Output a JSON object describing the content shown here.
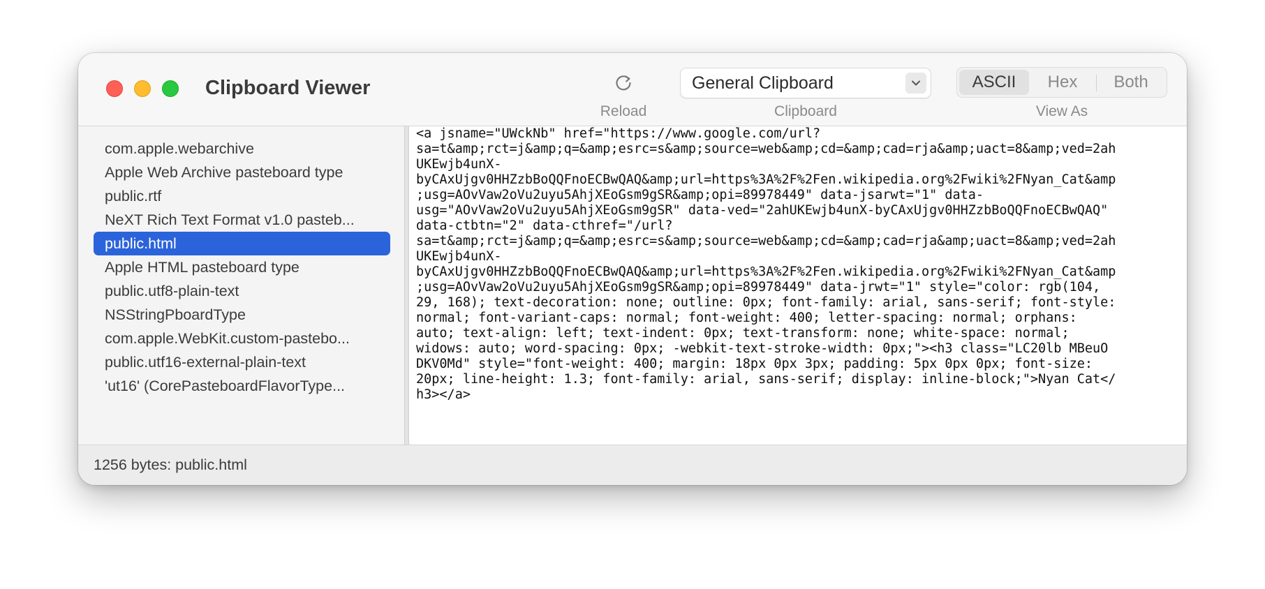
{
  "window": {
    "title": "Clipboard Viewer"
  },
  "toolbar": {
    "reload_icon": "reload-icon",
    "reload_label": "Reload",
    "clipboard_label": "Clipboard",
    "clipboard_value": "General Clipboard",
    "clipboard_chevron_icon": "chevron-down-icon",
    "view_as_label": "View As",
    "view_modes": [
      {
        "label": "ASCII",
        "selected": true
      },
      {
        "label": "Hex",
        "selected": false
      },
      {
        "label": "Both",
        "selected": false
      }
    ]
  },
  "sidebar": {
    "items": [
      {
        "label": "com.apple.webarchive"
      },
      {
        "label": "Apple Web Archive pasteboard type"
      },
      {
        "label": "public.rtf"
      },
      {
        "label": "NeXT Rich Text Format v1.0 pasteb..."
      },
      {
        "label": "public.html",
        "selected": true
      },
      {
        "label": "Apple HTML pasteboard type"
      },
      {
        "label": "public.utf8-plain-text"
      },
      {
        "label": "NSStringPboardType"
      },
      {
        "label": "com.apple.WebKit.custom-pastebo..."
      },
      {
        "label": "public.utf16-external-plain-text"
      },
      {
        "label": "'ut16' (CorePasteboardFlavorType..."
      }
    ]
  },
  "content": {
    "lines": [
      "<a jsname=\"UWckNb\" href=\"https://www.google.com/url?",
      "sa=t&amp;rct=j&amp;q=&amp;esrc=s&amp;source=web&amp;cd=&amp;cad=rja&amp;uact=8&amp;ved=2ah",
      "UKEwjb4unX-",
      "byCAxUjgv0HHZzbBoQQFnoECBwQAQ&amp;url=https%3A%2F%2Fen.wikipedia.org%2Fwiki%2FNyan_Cat&amp",
      ";usg=AOvVaw2oVu2uyu5AhjXEoGsm9gSR&amp;opi=89978449\" data-jsarwt=\"1\" data-",
      "usg=\"AOvVaw2oVu2uyu5AhjXEoGsm9gSR\" data-ved=\"2ahUKEwjb4unX-byCAxUjgv0HHZzbBoQQFnoECBwQAQ\"",
      "data-ctbtn=\"2\" data-cthref=\"/url?",
      "sa=t&amp;rct=j&amp;q=&amp;esrc=s&amp;source=web&amp;cd=&amp;cad=rja&amp;uact=8&amp;ved=2ah",
      "UKEwjb4unX-",
      "byCAxUjgv0HHZzbBoQQFnoECBwQAQ&amp;url=https%3A%2F%2Fen.wikipedia.org%2Fwiki%2FNyan_Cat&amp",
      ";usg=AOvVaw2oVu2uyu5AhjXEoGsm9gSR&amp;opi=89978449\" data-jrwt=\"1\" style=\"color: rgb(104,",
      "29, 168); text-decoration: none; outline: 0px; font-family: arial, sans-serif; font-style:",
      "normal; font-variant-caps: normal; font-weight: 400; letter-spacing: normal; orphans:",
      "auto; text-align: left; text-indent: 0px; text-transform: none; white-space: normal;",
      "widows: auto; word-spacing: 0px; -webkit-text-stroke-width: 0px;\"><h3 class=\"LC20lb MBeuO",
      "DKV0Md\" style=\"font-weight: 400; margin: 18px 0px 3px; padding: 5px 0px 0px; font-size:",
      "20px; line-height: 1.3; font-family: arial, sans-serif; display: inline-block;\">Nyan Cat</",
      "h3></a>"
    ]
  },
  "status": {
    "text": "1256 bytes: public.html"
  },
  "colors": {
    "selection": "#2b63da",
    "close": "#fe5f57",
    "minimize": "#febc2e",
    "zoom": "#28c840"
  }
}
